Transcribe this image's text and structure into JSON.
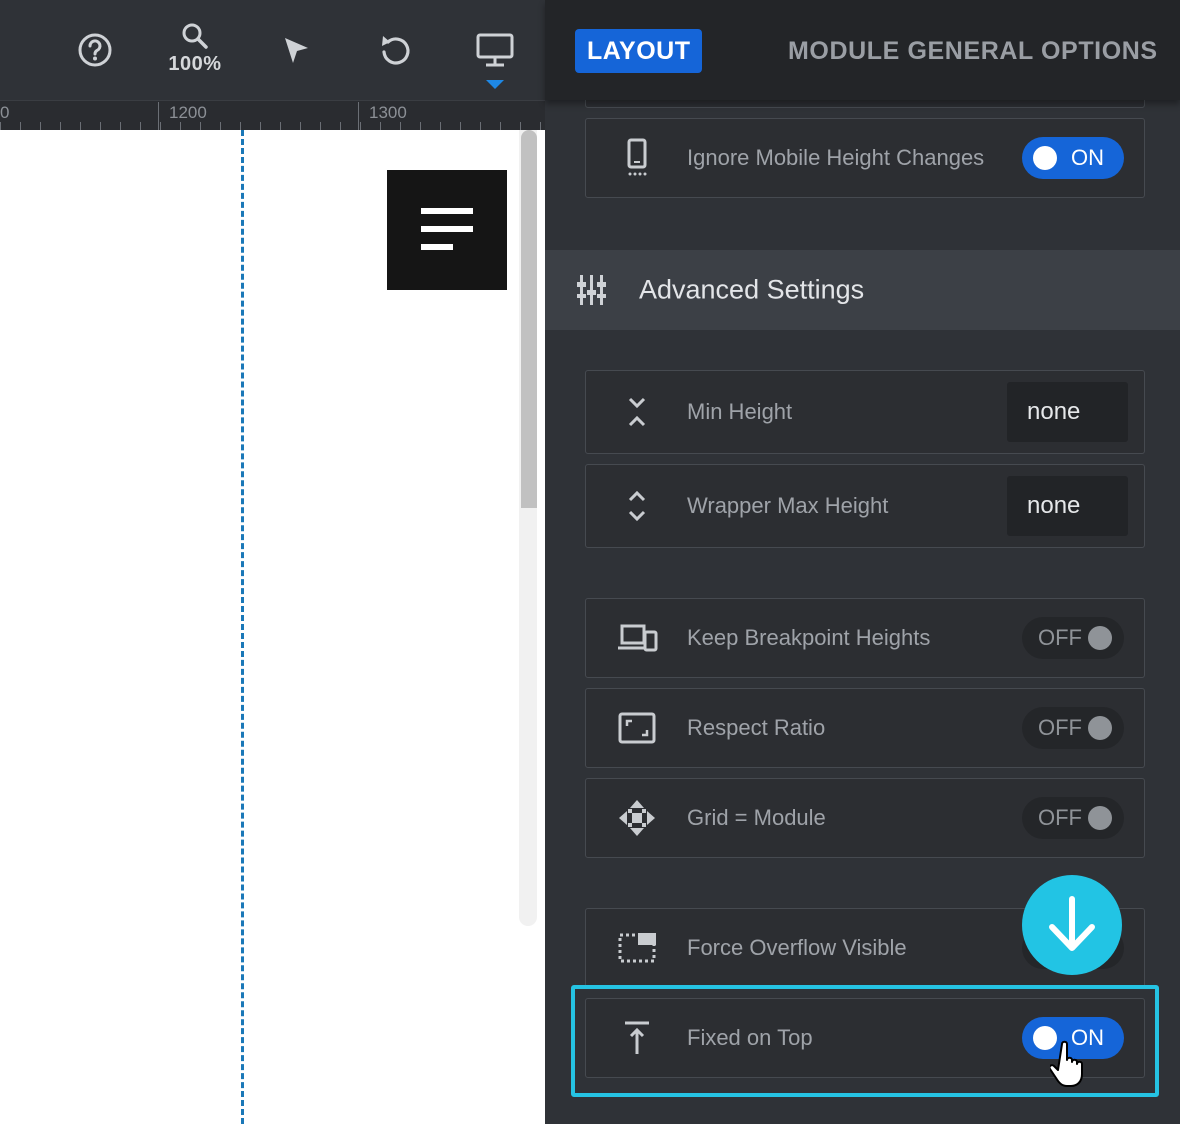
{
  "toolbar": {
    "help_icon": "help-circle-icon",
    "zoom_icon": "magnifier-icon",
    "zoom_level": "100%",
    "select_icon": "cursor-arrow-icon",
    "undo_icon": "undo-icon",
    "device_icon": "desktop-monitor-icon"
  },
  "ruler": {
    "labels": [
      "0",
      "1200",
      "1300"
    ]
  },
  "panel": {
    "tabs": {
      "active": "LAYOUT",
      "inactive": "MODULE GENERAL OPTIONS"
    },
    "rows_top": [
      {
        "label": "Ignore Mobile Height Changes",
        "icon": "mobile-phone-icon",
        "toggle": "ON"
      }
    ],
    "advanced": {
      "title": "Advanced Settings",
      "icon": "sliders-icon"
    },
    "height_rows": [
      {
        "label": "Min Height",
        "icon": "compress-vertical-icon",
        "value": "none"
      },
      {
        "label": "Wrapper Max Height",
        "icon": "expand-vertical-icon",
        "value": "none"
      }
    ],
    "toggle_rows": [
      {
        "label": "Keep Breakpoint Heights",
        "icon": "devices-icon",
        "toggle": "OFF"
      },
      {
        "label": "Respect Ratio",
        "icon": "aspect-ratio-icon",
        "toggle": "OFF"
      },
      {
        "label": "Grid = Module",
        "icon": "move-arrows-icon",
        "toggle": "OFF"
      }
    ],
    "overflow_row": {
      "label": "Force Overflow Visible",
      "icon": "overflow-box-icon"
    },
    "fixed_row": {
      "label": "Fixed on Top",
      "icon": "arrow-to-top-icon",
      "toggle": "ON"
    }
  },
  "colors": {
    "accent_blue": "#1565d8",
    "highlight_cyan": "#25c3e3",
    "guide_blue": "#1a78b8"
  }
}
